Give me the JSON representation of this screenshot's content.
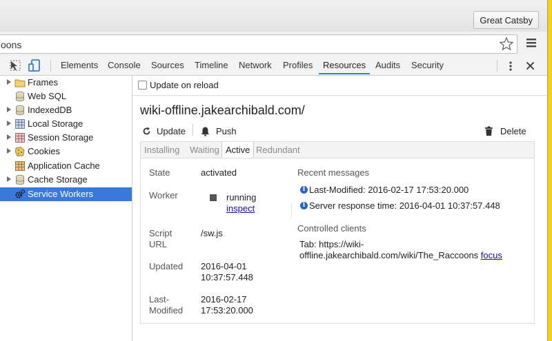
{
  "browser": {
    "profile_button": "Great Catsby",
    "url_fragment": "oons"
  },
  "devtools": {
    "tabs": [
      "Elements",
      "Console",
      "Sources",
      "Timeline",
      "Network",
      "Profiles",
      "Resources",
      "Audits",
      "Security"
    ],
    "active_tab": "Resources",
    "accent_color": "#3879d9"
  },
  "sidebar": {
    "items": [
      {
        "label": "Frames",
        "icon": "folder-icon",
        "expandable": true
      },
      {
        "label": "Web SQL",
        "icon": "database-icon",
        "expandable": false
      },
      {
        "label": "IndexedDB",
        "icon": "database-icon",
        "expandable": true
      },
      {
        "label": "Local Storage",
        "icon": "grid-icon",
        "expandable": true
      },
      {
        "label": "Session Storage",
        "icon": "grid-icon",
        "expandable": true
      },
      {
        "label": "Cookies",
        "icon": "cookie-icon",
        "expandable": true
      },
      {
        "label": "Application Cache",
        "icon": "grid-icon",
        "expandable": false
      },
      {
        "label": "Cache Storage",
        "icon": "database-icon",
        "expandable": true
      },
      {
        "label": "Service Workers",
        "icon": "gears-icon",
        "expandable": false,
        "selected": true
      }
    ]
  },
  "main": {
    "update_on_reload_label": "Update on reload",
    "origin": "wiki-offline.jakearchibald.com/",
    "actions": {
      "update": "Update",
      "push": "Push",
      "delete": "Delete"
    },
    "sw_tabs": [
      "Installing",
      "Waiting",
      "Active",
      "Redundant"
    ],
    "sw_active_tab": "Active",
    "fields": {
      "state_label": "State",
      "state_value": "activated",
      "worker_label": "Worker",
      "worker_status": "running",
      "worker_inspect": "inspect",
      "script_url_label_1": "Script",
      "script_url_label_2": "URL",
      "script_url_value": "/sw.js",
      "updated_label": "Updated",
      "updated_value_1": "2016-04-01",
      "updated_value_2": "10:37:57.448",
      "last_modified_label_1": "Last-",
      "last_modified_label_2": "Modified",
      "last_modified_value_1": "2016-02-17",
      "last_modified_value_2": "17:53:20.000"
    },
    "recent_messages_label": "Recent messages",
    "messages": [
      "Last-Modified: 2016-02-17 17:53:20.000",
      "Server response time: 2016-04-01 10:37:57.448"
    ],
    "controlled_clients_label": "Controlled clients",
    "client_line_1": "Tab: https://wiki-",
    "client_line_2": "offline.jakearchibald.com/wiki/The_Raccoons",
    "client_focus": "focus"
  }
}
